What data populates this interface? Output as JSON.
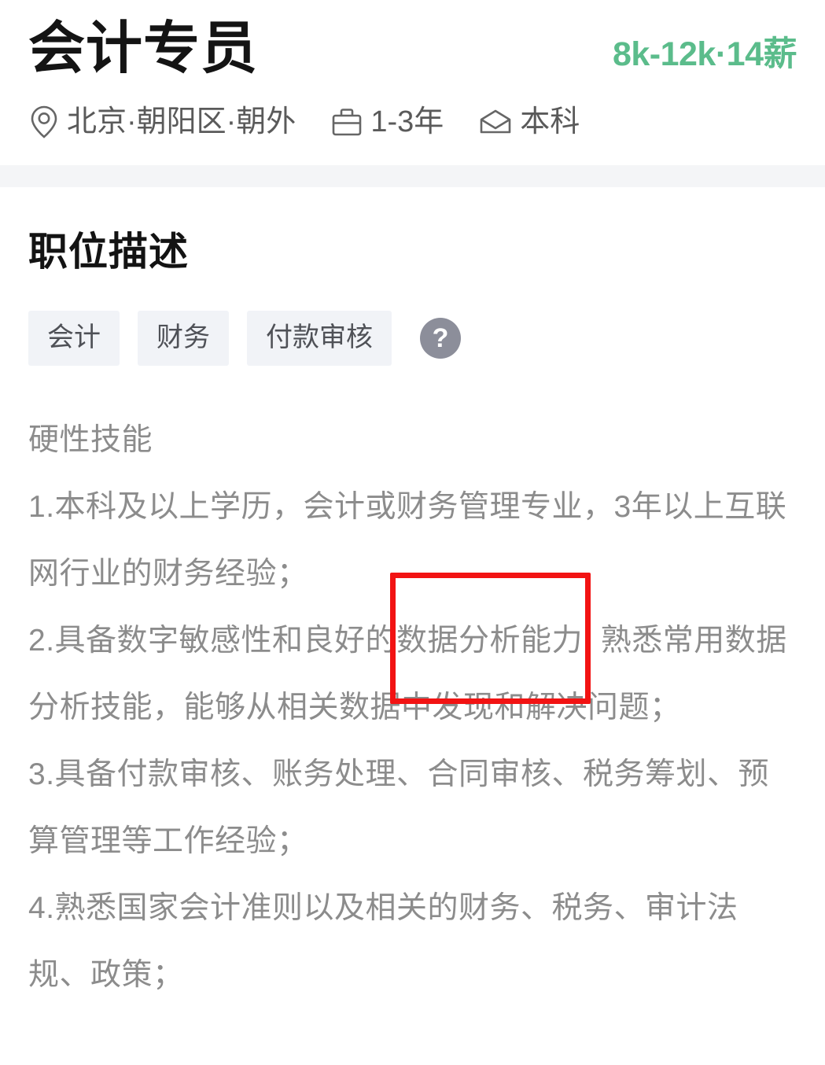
{
  "header": {
    "job_title": "会计专员",
    "salary": "8k-12k·14薪",
    "meta": [
      {
        "icon": "location-pin-icon",
        "label": "北京·朝阳区·朝外"
      },
      {
        "icon": "briefcase-icon",
        "label": "1-3年"
      },
      {
        "icon": "graduation-cap-icon",
        "label": "本科"
      }
    ]
  },
  "description": {
    "section_title": "职位描述",
    "tags": [
      "会计",
      "财务",
      "付款审核"
    ],
    "help_icon_label": "?",
    "body": {
      "heading": "硬性技能",
      "item1": "1.本科及以上学历，会计或财务管理专业，3年以上互联网行业的财务经验；",
      "item2_before": "2.具备数字敏感性和良好的",
      "item2_highlight": "数据分析能力",
      "item2_after": "  熟悉常用数据分析技能，能够从相关数据中发现和解决问题；",
      "item3": "3.具备付款审核、账务处理、合同审核、税务筹划、预算管理等工作经验；",
      "item4": "4.熟悉国家会计准则以及相关的财务、税务、审计法规、政策；"
    }
  },
  "colors": {
    "salary_green": "#5BBC8B",
    "highlight_red": "#F21313",
    "tag_background": "#F1F3F7",
    "body_text": "#8C8C8C",
    "divider_band": "#F4F5F7",
    "help_badge": "#8C8E9A"
  }
}
